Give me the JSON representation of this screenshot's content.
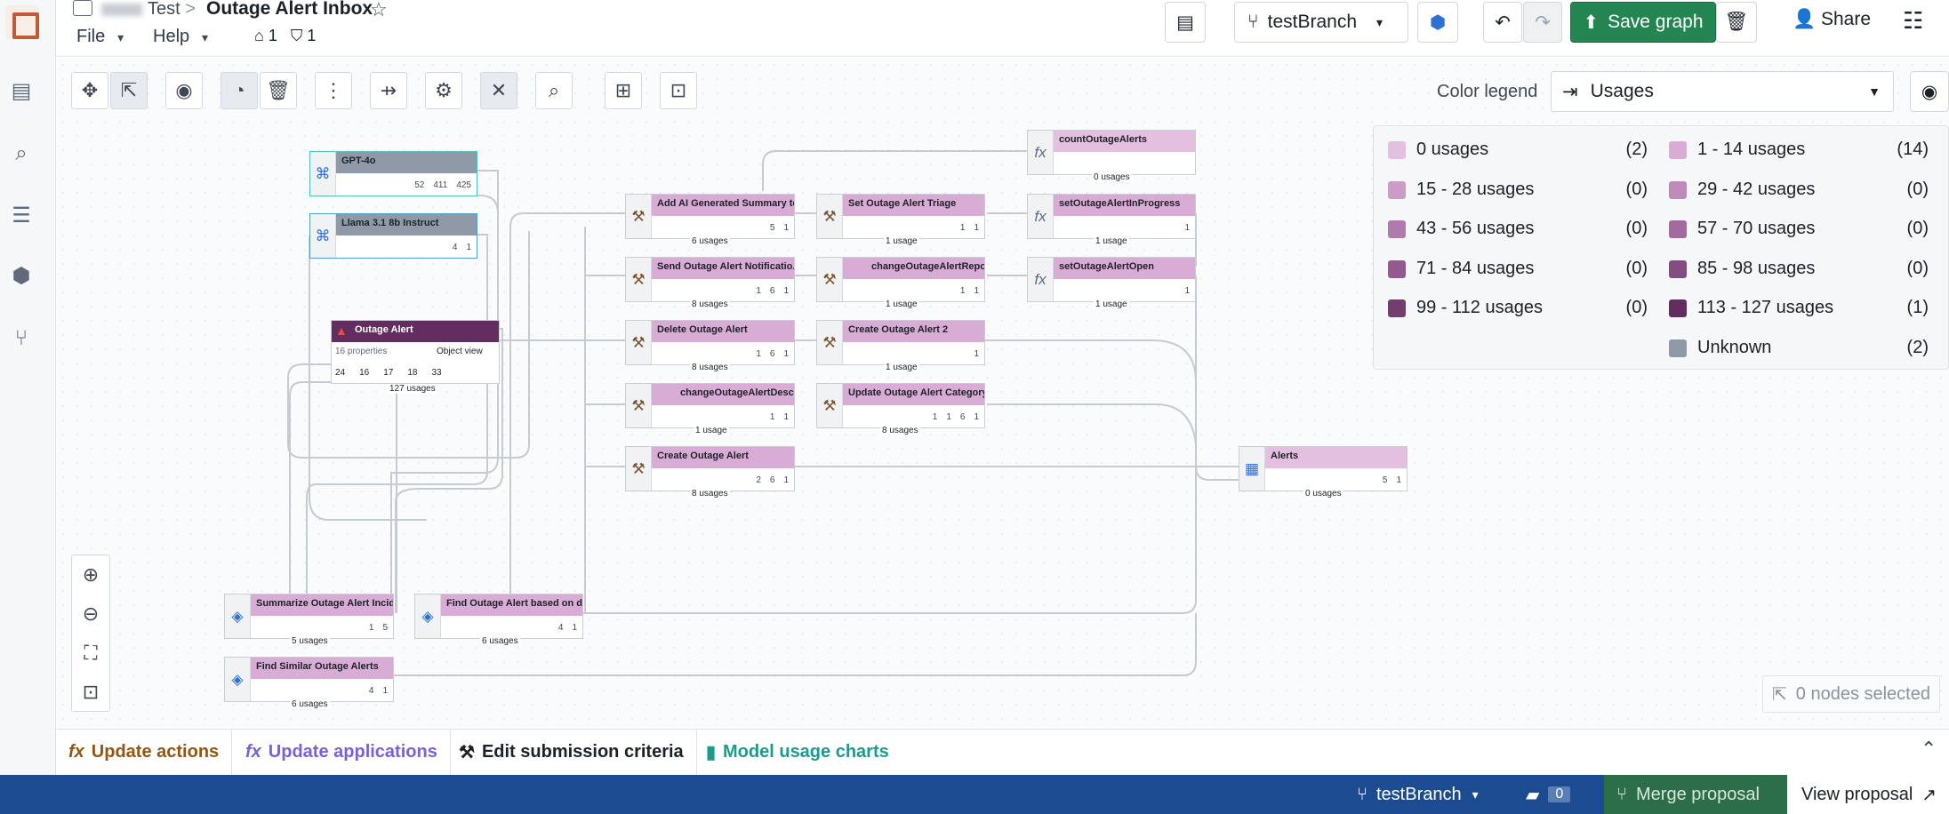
{
  "header": {
    "breadcrumb_parent": "Test",
    "breadcrumb_sep": ">",
    "title": "Outage Alert Inbox",
    "menus": [
      "File",
      "Help"
    ],
    "object_count": "1",
    "shield_count": "1"
  },
  "toolbar": {
    "branch": "testBranch",
    "save_label": "Save graph",
    "share_label": "Share"
  },
  "legend": {
    "label": "Color legend",
    "select": "Usages",
    "items": [
      {
        "label": "0 usages",
        "count": "(2)",
        "color": "#e3bfe0"
      },
      {
        "label": "1 - 14 usages",
        "count": "(14)",
        "color": "#d9acd6"
      },
      {
        "label": "15 - 28 usages",
        "count": "(0)",
        "color": "#cc9bc8"
      },
      {
        "label": "29 - 42 usages",
        "count": "(0)",
        "color": "#be8aba"
      },
      {
        "label": "43 - 56 usages",
        "count": "(0)",
        "color": "#b17aad"
      },
      {
        "label": "57 - 70 usages",
        "count": "(0)",
        "color": "#a46aa0"
      },
      {
        "label": "71 - 84 usages",
        "count": "(0)",
        "color": "#935a8f"
      },
      {
        "label": "85 - 98 usages",
        "count": "(0)",
        "color": "#844c80"
      },
      {
        "label": "99 - 112 usages",
        "count": "(0)",
        "color": "#733d6f"
      },
      {
        "label": "113 - 127 usages",
        "count": "(1)",
        "color": "#632e5f"
      },
      {
        "label": "Unknown",
        "count": "(2)",
        "color": "#8f99a8"
      }
    ]
  },
  "nodes": {
    "gpt": {
      "name": "GPT-4o",
      "s1": "52",
      "s2": "411",
      "s3": "425"
    },
    "llama": {
      "name": "Llama 3.1 8b Instruct",
      "s1": "4",
      "s2": "1"
    },
    "outage": {
      "name": "Outage Alert",
      "props": "16 properties",
      "view": "Object view",
      "s1": "24",
      "s2": "16",
      "s3": "17",
      "s4": "18",
      "s5": "33",
      "usage": "127 usages"
    },
    "addai": {
      "name": "Add AI Generated Summary to...",
      "s1": "5",
      "s2": "1",
      "usage": "6 usages"
    },
    "sendnotif": {
      "name": "Send Outage Alert Notificatio...",
      "s1": "1",
      "s2": "6",
      "s3": "1",
      "usage": "8 usages"
    },
    "delete": {
      "name": "Delete Outage Alert",
      "s1": "1",
      "s2": "6",
      "s3": "1",
      "usage": "8 usages"
    },
    "changedesc": {
      "name": "changeOutageAlertDescr...",
      "s1": "1",
      "s2": "1",
      "usage": "1 usage"
    },
    "create": {
      "name": "Create Outage Alert",
      "s1": "2",
      "s2": "6",
      "s3": "1",
      "usage": "8 usages"
    },
    "triage": {
      "name": "Set Outage Alert Triage",
      "s1": "1",
      "s2": "1",
      "usage": "1 usage"
    },
    "changerepo": {
      "name": "changeOutageAlertRepo...",
      "s1": "1",
      "s2": "1",
      "usage": "1 usage"
    },
    "create2": {
      "name": "Create Outage Alert 2",
      "s1": "1",
      "usage": "1 usage"
    },
    "updcat": {
      "name": "Update Outage Alert Category",
      "s1": "1",
      "s2": "1",
      "s3": "6",
      "s4": "1",
      "usage": "8 usages"
    },
    "count": {
      "name": "countOutageAlerts",
      "usage": "0 usages"
    },
    "inprog": {
      "name": "setOutageAlertInProgress",
      "s1": "1",
      "usage": "1 usage"
    },
    "open": {
      "name": "setOutageAlertOpen",
      "s1": "1",
      "usage": "1 usage"
    },
    "alerts": {
      "name": "Alerts",
      "s1": "5",
      "s2": "1",
      "usage": "0 usages"
    },
    "summarize": {
      "name": "Summarize Outage Alert Incid...",
      "s1": "1",
      "s2": "5",
      "usage": "5 usages"
    },
    "find": {
      "name": "Find Outage Alert based on de...",
      "s1": "4",
      "s2": "1",
      "usage": "6 usages"
    },
    "similar": {
      "name": "Find Similar Outage Alerts",
      "s1": "4",
      "s2": "1",
      "usage": "6 usages"
    }
  },
  "selection": "0 nodes selected",
  "bottom_tabs": [
    "Update actions",
    "Update applications",
    "Edit submission criteria",
    "Model usage charts"
  ],
  "status": {
    "branch": "testBranch",
    "count": "0",
    "merge": "Merge proposal",
    "view": "View proposal"
  }
}
